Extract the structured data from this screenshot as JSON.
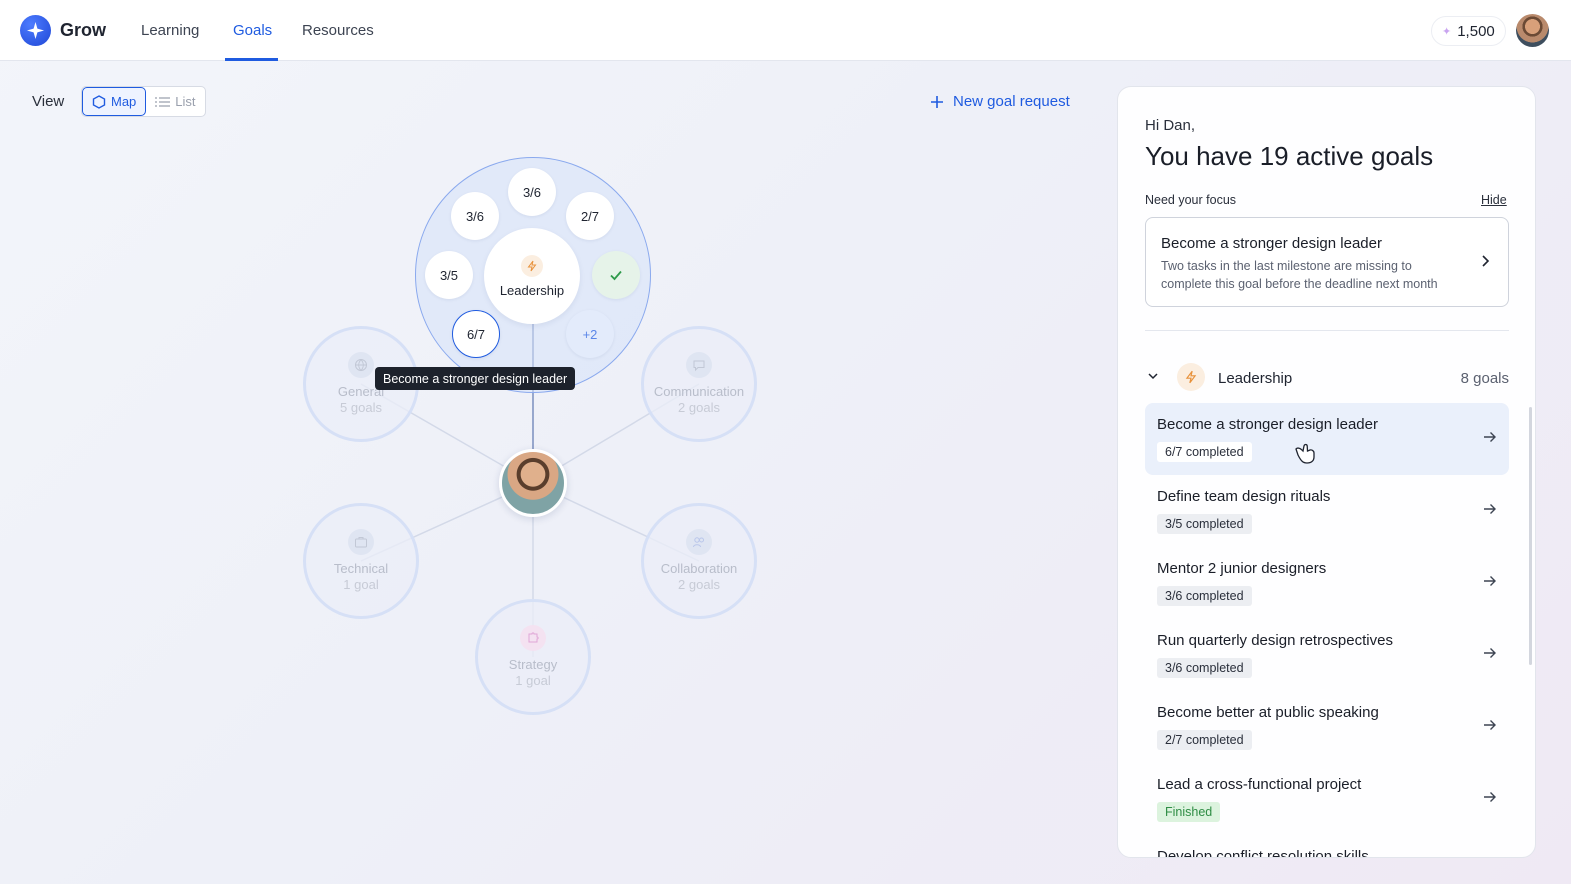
{
  "app": {
    "brand": "Grow",
    "points": "1,500"
  },
  "nav": {
    "items": [
      {
        "label": "Learning"
      },
      {
        "label": "Goals"
      },
      {
        "label": "Resources"
      }
    ],
    "active": "Goals"
  },
  "view": {
    "label": "View",
    "map": "Map",
    "list": "List",
    "selected": "Map"
  },
  "actions": {
    "new_goal": "New goal request"
  },
  "map": {
    "focus_category": "Leadership",
    "progress_chips": [
      "3/6",
      "3/6",
      "2/7",
      "3/5",
      "6/7",
      "+2"
    ],
    "tooltip": "Become a stronger design leader",
    "categories": [
      {
        "name": "General",
        "count": "5 goals",
        "icon": "globe-icon"
      },
      {
        "name": "Communication",
        "count": "2 goals",
        "icon": "chat-icon"
      },
      {
        "name": "Technical",
        "count": "1 goal",
        "icon": "briefcase-icon"
      },
      {
        "name": "Collaboration",
        "count": "2 goals",
        "icon": "people-icon"
      },
      {
        "name": "Strategy",
        "count": "1 goal",
        "icon": "puzzle-icon"
      }
    ]
  },
  "panel": {
    "greeting": "Hi Dan,",
    "headline": "You have 19 active goals",
    "focus_label": "Need your focus",
    "hide": "Hide",
    "focus_card": {
      "title": "Become a stronger design leader",
      "desc": "Two tasks in the last milestone are missing to complete this goal before the deadline next month"
    },
    "group": {
      "name": "Leadership",
      "count": "8 goals"
    },
    "goals": [
      {
        "title": "Become a stronger design leader",
        "status": "6/7 completed"
      },
      {
        "title": "Define team design rituals",
        "status": "3/5 completed"
      },
      {
        "title": "Mentor 2 junior designers",
        "status": "3/6 completed"
      },
      {
        "title": "Run quarterly design retrospectives",
        "status": "3/6 completed"
      },
      {
        "title": "Become better at public speaking",
        "status": "2/7 completed"
      },
      {
        "title": "Lead a cross-functional project",
        "status": "Finished"
      },
      {
        "title": "Develop conflict resolution skills",
        "status": ""
      }
    ]
  },
  "colors": {
    "accent": "#1f5be0",
    "leadership": "#e8913a",
    "finished": "#2f8d45"
  }
}
